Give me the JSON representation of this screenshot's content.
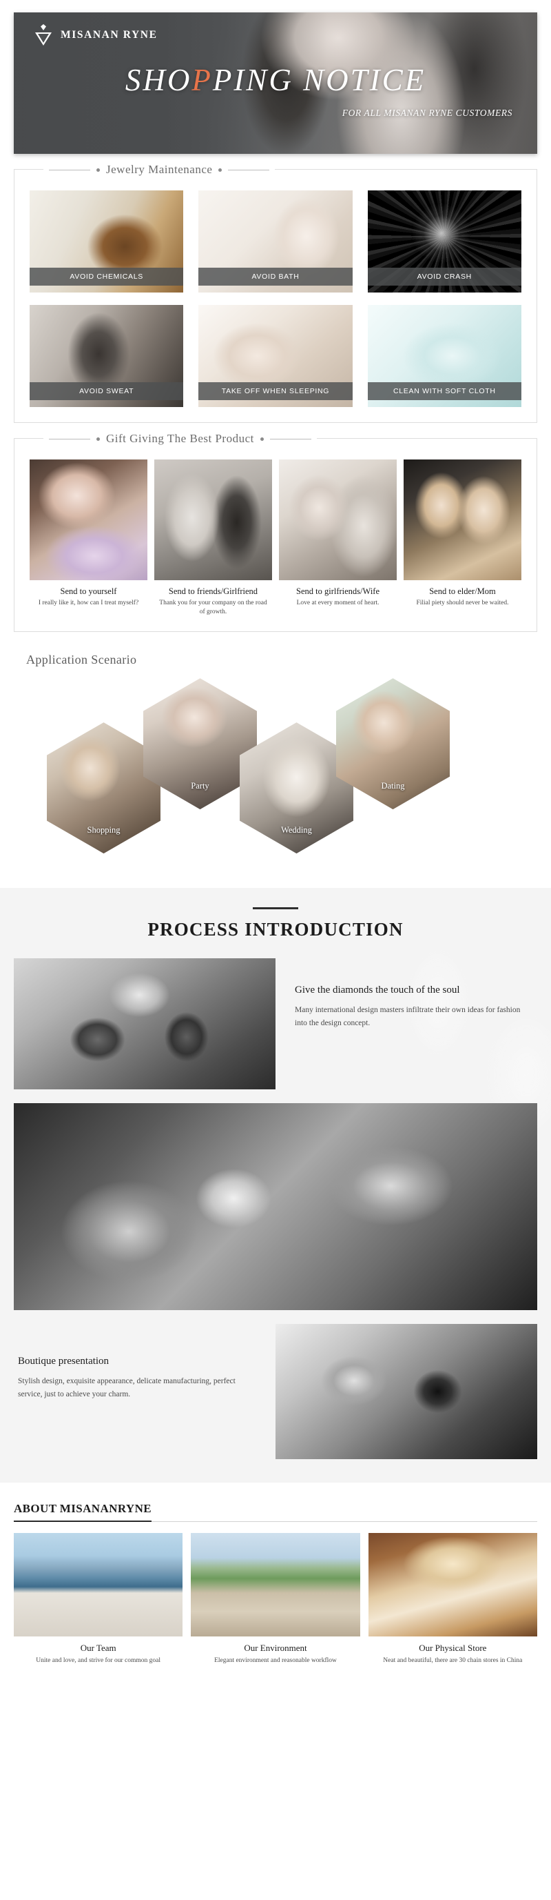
{
  "banner": {
    "brand": "MISANAN RYNE",
    "title_pre": "SHO",
    "title_hl": "P",
    "title_post": "PING NOTICE",
    "title_full": "SHOPPING NOTICE",
    "subtitle": "FOR ALL MISANAN RYNE CUSTOMERS",
    "accent_color": "#e8744a",
    "bg_color": "#4e5052"
  },
  "maintenance": {
    "heading": "Jewelry Maintenance",
    "items": [
      {
        "caption": "AVOID CHEMICALS"
      },
      {
        "caption": "AVOID BATH"
      },
      {
        "caption": "AVOID CRASH"
      },
      {
        "caption": "AVOID SWEAT"
      },
      {
        "caption": "TAKE OFF WHEN SLEEPING"
      },
      {
        "caption": "CLEAN WITH SOFT CLOTH"
      }
    ]
  },
  "gift": {
    "heading": "Gift Giving The Best Product",
    "items": [
      {
        "title": "Send to yourself",
        "desc": "I really like it, how can I treat myself?"
      },
      {
        "title": "Send to friends/Girlfriend",
        "desc": "Thank you for your company on the road of growth."
      },
      {
        "title": "Send to girlfriends/Wife",
        "desc": "Love at every moment of heart."
      },
      {
        "title": "Send to elder/Mom",
        "desc": "Filial piety should never be waited."
      }
    ]
  },
  "scenario": {
    "heading": "Application Scenario",
    "items": [
      {
        "label": "Shopping"
      },
      {
        "label": "Party"
      },
      {
        "label": "Wedding"
      },
      {
        "label": "Dating"
      }
    ]
  },
  "process": {
    "title": "PROCESS INTRODUCTION",
    "block_a": {
      "heading": "Give the diamonds the touch of the soul",
      "body": "Many international design masters infiltrate their own ideas for fashion into the design concept."
    },
    "block_b": {
      "heading": "Boutique presentation",
      "body": "Stylish design, exquisite appearance, delicate manufacturing, perfect service, just to achieve your charm."
    }
  },
  "about": {
    "title": "ABOUT MISANANRYNE",
    "items": [
      {
        "title": "Our Team",
        "desc": "Unite and love, and strive for our common goal"
      },
      {
        "title": "Our Environment",
        "desc": "Elegant environment and reasonable workflow"
      },
      {
        "title": "Our Physical Store",
        "desc": "Neat and beautiful, there are 30 chain stores in China"
      }
    ]
  }
}
